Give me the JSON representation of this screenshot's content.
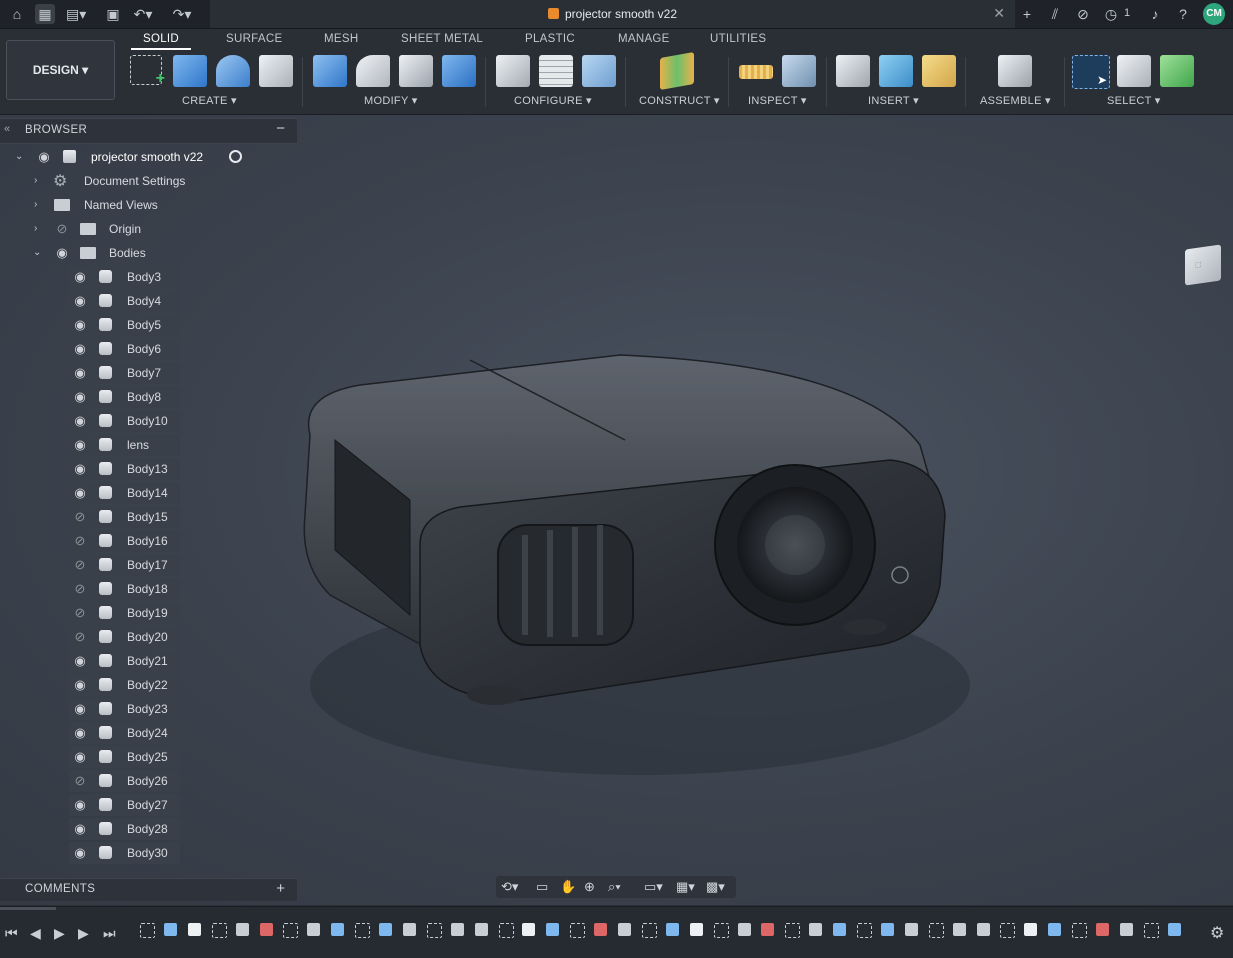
{
  "document": {
    "title": "projector smooth v22"
  },
  "topbar": {
    "notifications_count": "1",
    "user_initials": "CM"
  },
  "toolbar": {
    "workspace": "DESIGN",
    "tabs": [
      "SOLID",
      "SURFACE",
      "MESH",
      "SHEET METAL",
      "PLASTIC",
      "MANAGE",
      "UTILITIES"
    ],
    "groups": [
      "CREATE",
      "MODIFY",
      "CONFIGURE",
      "CONSTRUCT",
      "INSPECT",
      "INSERT",
      "ASSEMBLE",
      "SELECT"
    ]
  },
  "browser": {
    "title": "BROWSER",
    "root": "projector smooth v22",
    "folders": [
      "Document Settings",
      "Named Views",
      "Origin",
      "Bodies"
    ],
    "bodies": [
      {
        "name": "Body3",
        "visible": true
      },
      {
        "name": "Body4",
        "visible": true
      },
      {
        "name": "Body5",
        "visible": true
      },
      {
        "name": "Body6",
        "visible": true
      },
      {
        "name": "Body7",
        "visible": true
      },
      {
        "name": "Body8",
        "visible": true
      },
      {
        "name": "Body10",
        "visible": true
      },
      {
        "name": "lens",
        "visible": true
      },
      {
        "name": "Body13",
        "visible": true
      },
      {
        "name": "Body14",
        "visible": true
      },
      {
        "name": "Body15",
        "visible": false
      },
      {
        "name": "Body16",
        "visible": false
      },
      {
        "name": "Body17",
        "visible": false
      },
      {
        "name": "Body18",
        "visible": false
      },
      {
        "name": "Body19",
        "visible": false
      },
      {
        "name": "Body20",
        "visible": false
      },
      {
        "name": "Body21",
        "visible": true
      },
      {
        "name": "Body22",
        "visible": true
      },
      {
        "name": "Body23",
        "visible": true
      },
      {
        "name": "Body24",
        "visible": true
      },
      {
        "name": "Body25",
        "visible": true
      },
      {
        "name": "Body26",
        "visible": false
      },
      {
        "name": "Body27",
        "visible": true
      },
      {
        "name": "Body28",
        "visible": true
      },
      {
        "name": "Body30",
        "visible": true
      }
    ]
  },
  "comments": {
    "title": "COMMENTS"
  },
  "colors": {
    "accent": "#2ea67c",
    "doc_icon": "#e98a2c"
  }
}
